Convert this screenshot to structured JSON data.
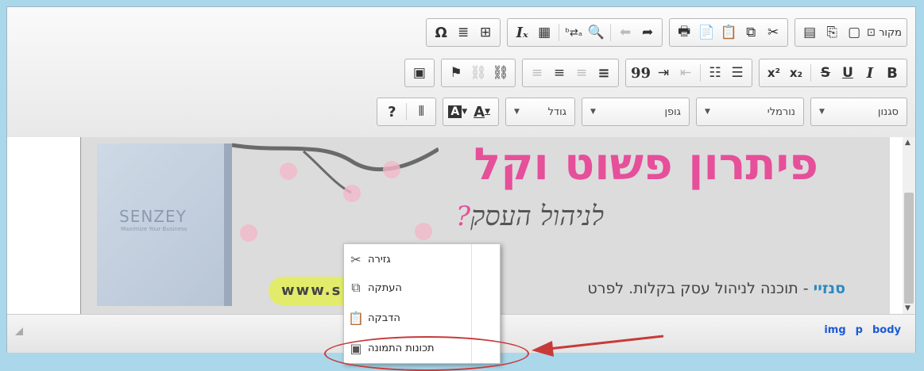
{
  "toolbar": {
    "row1": [
      {
        "name": "source-button",
        "label": "מקור",
        "icon": "source-icon",
        "glyph": "⊡"
      },
      {
        "name": "new-page-button",
        "icon": "new-page-icon",
        "glyph": "▢"
      },
      {
        "name": "templates-button",
        "icon": "templates-icon",
        "glyph": "⎘"
      },
      {
        "name": "preview-button",
        "icon": "preview-icon",
        "glyph": "▤"
      },
      {
        "name": "cut-button",
        "icon": "cut-icon",
        "glyph": "✂"
      },
      {
        "name": "copy-button",
        "icon": "copy-icon",
        "glyph": "⧉"
      },
      {
        "name": "paste-button",
        "icon": "paste-icon",
        "glyph": "📋"
      },
      {
        "name": "paste-text-button",
        "icon": "paste-text-icon",
        "glyph": "📄"
      },
      {
        "name": "print-button",
        "icon": "print-icon",
        "glyph": "🖶"
      },
      {
        "name": "redo-button",
        "icon": "redo-icon",
        "glyph": "➦"
      },
      {
        "name": "undo-button",
        "icon": "undo-icon",
        "glyph": "⬅"
      },
      {
        "name": "find-button",
        "icon": "search-icon",
        "glyph": "🔍"
      },
      {
        "name": "replace-button",
        "icon": "replace-icon",
        "glyph": "ᵇ⇄ₐ"
      },
      {
        "name": "spellcheck-button",
        "icon": "spellcheck-icon",
        "glyph": "▦"
      },
      {
        "name": "remove-format-button",
        "icon": "remove-format-icon",
        "glyph": "Iₓ"
      },
      {
        "name": "table-button",
        "icon": "table-icon",
        "glyph": "⊞"
      },
      {
        "name": "horizontal-line-button",
        "icon": "horizontal-line-icon",
        "glyph": "≣"
      },
      {
        "name": "special-char-button",
        "icon": "omega-icon",
        "glyph": "Ω"
      }
    ],
    "row2": [
      {
        "name": "bold-button",
        "icon": "bold-icon",
        "glyph": "B"
      },
      {
        "name": "italic-button",
        "icon": "italic-icon",
        "glyph": "I"
      },
      {
        "name": "underline-button",
        "icon": "underline-icon",
        "glyph": "U"
      },
      {
        "name": "strike-button",
        "icon": "strikethrough-icon",
        "glyph": "S"
      },
      {
        "name": "subscript-button",
        "icon": "subscript-icon",
        "glyph": "x₂"
      },
      {
        "name": "superscript-button",
        "icon": "superscript-icon",
        "glyph": "x²"
      },
      {
        "name": "numbered-list-button",
        "icon": "numbered-list-icon",
        "glyph": "☰"
      },
      {
        "name": "bulleted-list-button",
        "icon": "bulleted-list-icon",
        "glyph": "☷"
      },
      {
        "name": "outdent-button",
        "icon": "outdent-icon",
        "glyph": "⇤"
      },
      {
        "name": "indent-button",
        "icon": "indent-icon",
        "glyph": "⇥"
      },
      {
        "name": "blockquote-button",
        "icon": "blockquote-icon",
        "glyph": "99"
      },
      {
        "name": "align-right-button",
        "icon": "align-right-icon",
        "glyph": "≡"
      },
      {
        "name": "align-center-button",
        "icon": "align-center-icon",
        "glyph": "≡"
      },
      {
        "name": "align-left-button",
        "icon": "align-left-icon",
        "glyph": "≡"
      },
      {
        "name": "align-justify-button",
        "icon": "align-justify-icon",
        "glyph": "≡"
      },
      {
        "name": "link-button",
        "icon": "link-icon",
        "glyph": "⛓"
      },
      {
        "name": "unlink-button",
        "icon": "unlink-icon",
        "glyph": "⛓"
      },
      {
        "name": "anchor-button",
        "icon": "flag-icon",
        "glyph": "⚑"
      },
      {
        "name": "image-button",
        "icon": "image-icon",
        "glyph": "▣"
      }
    ],
    "row3": {
      "style_label": "סגנון",
      "format_label": "נורמלי",
      "font_label": "גופן",
      "size_label": "גודל",
      "text_color_glyph": "A",
      "bg_color_glyph": "A",
      "blocks_glyph": "⫴",
      "help_glyph": "?"
    }
  },
  "banner": {
    "brand": "SENZEY",
    "brand_tag": "Maximize Your Business",
    "headline": "פיתרון פשוט וקל",
    "subline": "לניהול העסק",
    "subline_mark": "?",
    "url": "www.s",
    "tagline_brand": "סנזיי",
    "tagline_rest": " - תוכנה לניהול עסק בקלות. לפרט"
  },
  "context_menu": [
    {
      "name": "ctx-cut",
      "label": "גזירה",
      "icon": "cut-icon",
      "glyph": "✂"
    },
    {
      "name": "ctx-copy",
      "label": "העתקה",
      "icon": "copy-icon",
      "glyph": "⧉"
    },
    {
      "name": "ctx-paste",
      "label": "הדבקה",
      "icon": "paste-icon",
      "glyph": "📋"
    },
    {
      "name": "ctx-image-properties",
      "label": "תכונות התמונה",
      "icon": "image-icon",
      "glyph": "▣"
    }
  ],
  "status_path": [
    "img",
    "p",
    "body"
  ],
  "colors": {
    "accent": "#1a5ad8",
    "headline": "#e64f9a",
    "highlight": "#c83a3a"
  }
}
